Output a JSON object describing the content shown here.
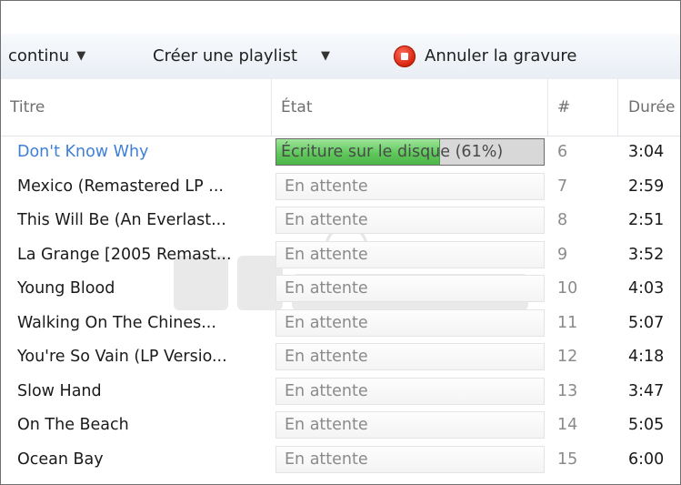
{
  "toolbar": {
    "mode_label": "continu",
    "create_playlist_label": "Créer une playlist",
    "cancel_burn_label": "Annuler la gravure"
  },
  "columns": {
    "title": "Titre",
    "status": "État",
    "number": "#",
    "duration": "Durée"
  },
  "rows": [
    {
      "title": "Don't Know Why",
      "status": "Écriture sur le disque (61%)",
      "number": "6",
      "duration": "3:04",
      "progress": 0.61,
      "active": true
    },
    {
      "title": "Mexico (Remastered LP ...",
      "status": "En attente",
      "number": "7",
      "duration": "2:59"
    },
    {
      "title": "This Will Be (An Everlast...",
      "status": "En attente",
      "number": "8",
      "duration": "2:51"
    },
    {
      "title": "La Grange [2005 Remast...",
      "status": "En attente",
      "number": "9",
      "duration": "3:52"
    },
    {
      "title": "Young Blood",
      "status": "En attente",
      "number": "10",
      "duration": "4:03"
    },
    {
      "title": "Walking On The Chines...",
      "status": "En attente",
      "number": "11",
      "duration": "5:07"
    },
    {
      "title": "You're So Vain (LP Versio...",
      "status": "En attente",
      "number": "12",
      "duration": "4:18"
    },
    {
      "title": "Slow Hand",
      "status": "En attente",
      "number": "13",
      "duration": "3:47"
    },
    {
      "title": "On The Beach",
      "status": "En attente",
      "number": "14",
      "duration": "5:05"
    },
    {
      "title": "Ocean Bay",
      "status": "En attente",
      "number": "15",
      "duration": "6:00"
    }
  ],
  "colors": {
    "active_title": "#3f7fd8",
    "progress_fill": "#5fc85b",
    "stop_icon": "#d82510"
  },
  "icons": {
    "mode_dropdown": "chevron-down-icon",
    "playlist_dropdown": "chevron-down-icon",
    "cancel_burn": "stop-icon"
  }
}
